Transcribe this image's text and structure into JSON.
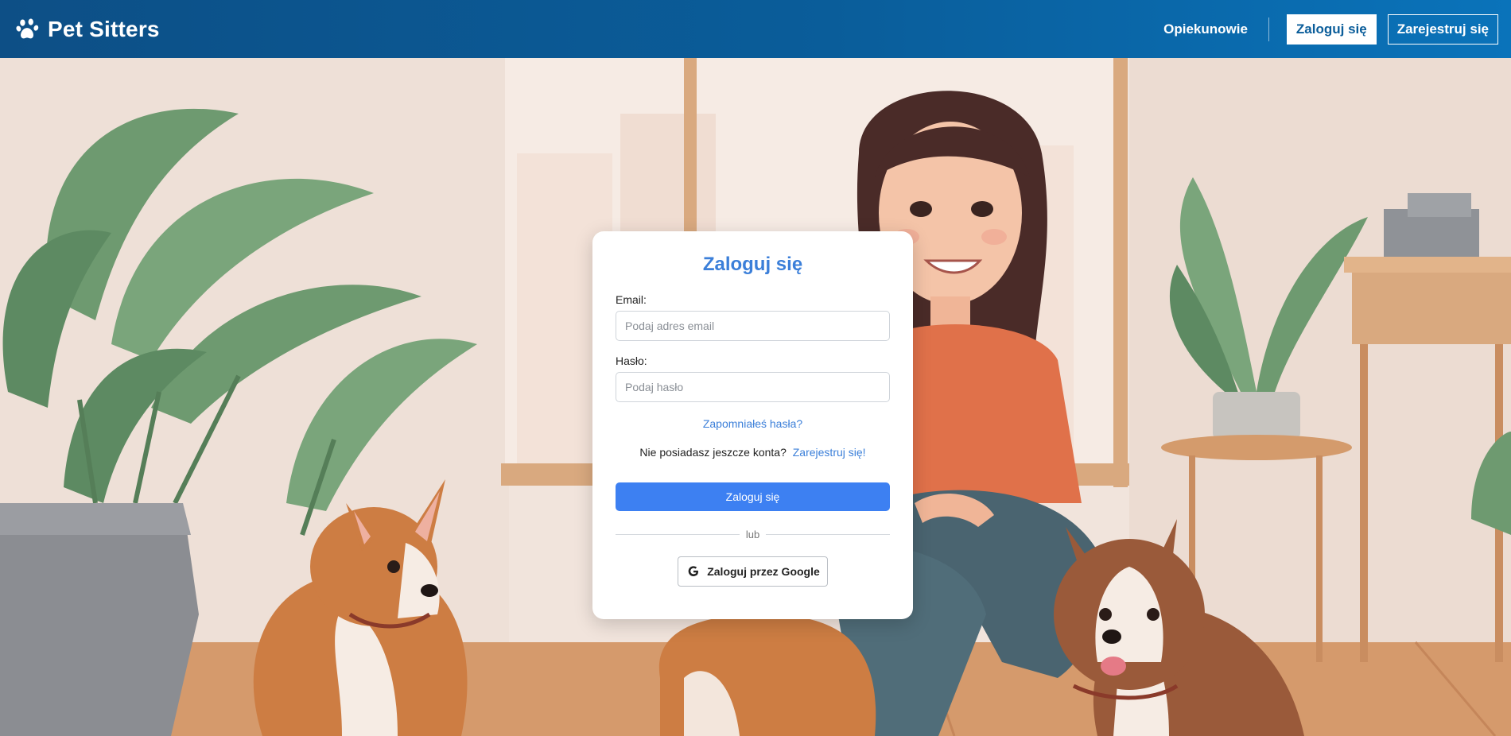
{
  "navbar": {
    "brand_name": "Pet Sitters",
    "brand_icon": "paw-icon",
    "links": {
      "sitters": "Opiekunowie"
    },
    "login_button": "Zaloguj się",
    "register_button": "Zarejestruj się"
  },
  "login_card": {
    "title": "Zaloguj się",
    "email_label": "Email:",
    "email_placeholder": "Podaj adres email",
    "email_value": "",
    "password_label": "Hasło:",
    "password_placeholder": "Podaj hasło",
    "password_value": "",
    "forgot_link": "Zapomniałeś hasła?",
    "no_account_text": "Nie posiadasz jeszcze konta?",
    "register_link": "Zarejestruj się!",
    "submit_button": "Zaloguj się",
    "divider_text": "lub",
    "google_button": "Zaloguj przez Google",
    "google_icon": "google-icon"
  },
  "colors": {
    "navbar_start": "#0d4f86",
    "navbar_end": "#0a73ba",
    "accent": "#3b7fd9",
    "submit_bg": "#3d80f2"
  }
}
